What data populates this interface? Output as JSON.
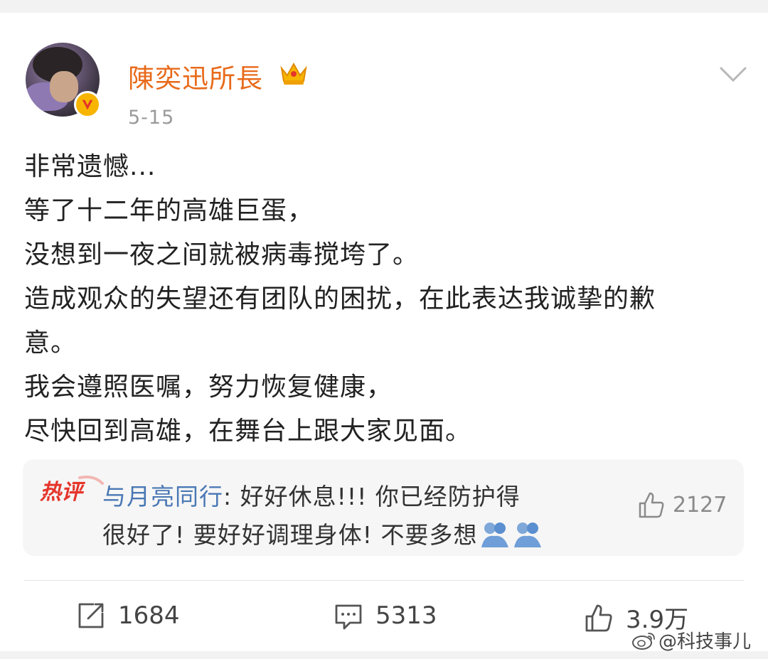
{
  "header": {
    "username": "陳奕迅所長",
    "date": "5-15"
  },
  "post": {
    "lines": [
      "非常遗憾...",
      "等了十二年的高雄巨蛋，",
      "没想到一夜之间就被病毒搅垮了。",
      "造成观众的失望还有团队的困扰，在此表达我诚挚的歉",
      "意。",
      "我会遵照医嘱，努力恢复健康，",
      "尽快回到高雄，在舞台上跟大家见面。"
    ]
  },
  "hot_comment": {
    "badge": "热评",
    "user": "与月亮同行",
    "separator": ": ",
    "text_line1": "好好休息!!! 你已经防护得",
    "text_line2": "很好了! 要好好调理身体! 不要多想",
    "likes": "2127"
  },
  "actions": {
    "repost_count": "1684",
    "comment_count": "5313",
    "like_count": "3.9万"
  },
  "watermark": {
    "text": "@科技事儿"
  },
  "colors": {
    "username": "#e86a1a",
    "link": "#4a78b5",
    "badge_red": "#e5352b"
  }
}
